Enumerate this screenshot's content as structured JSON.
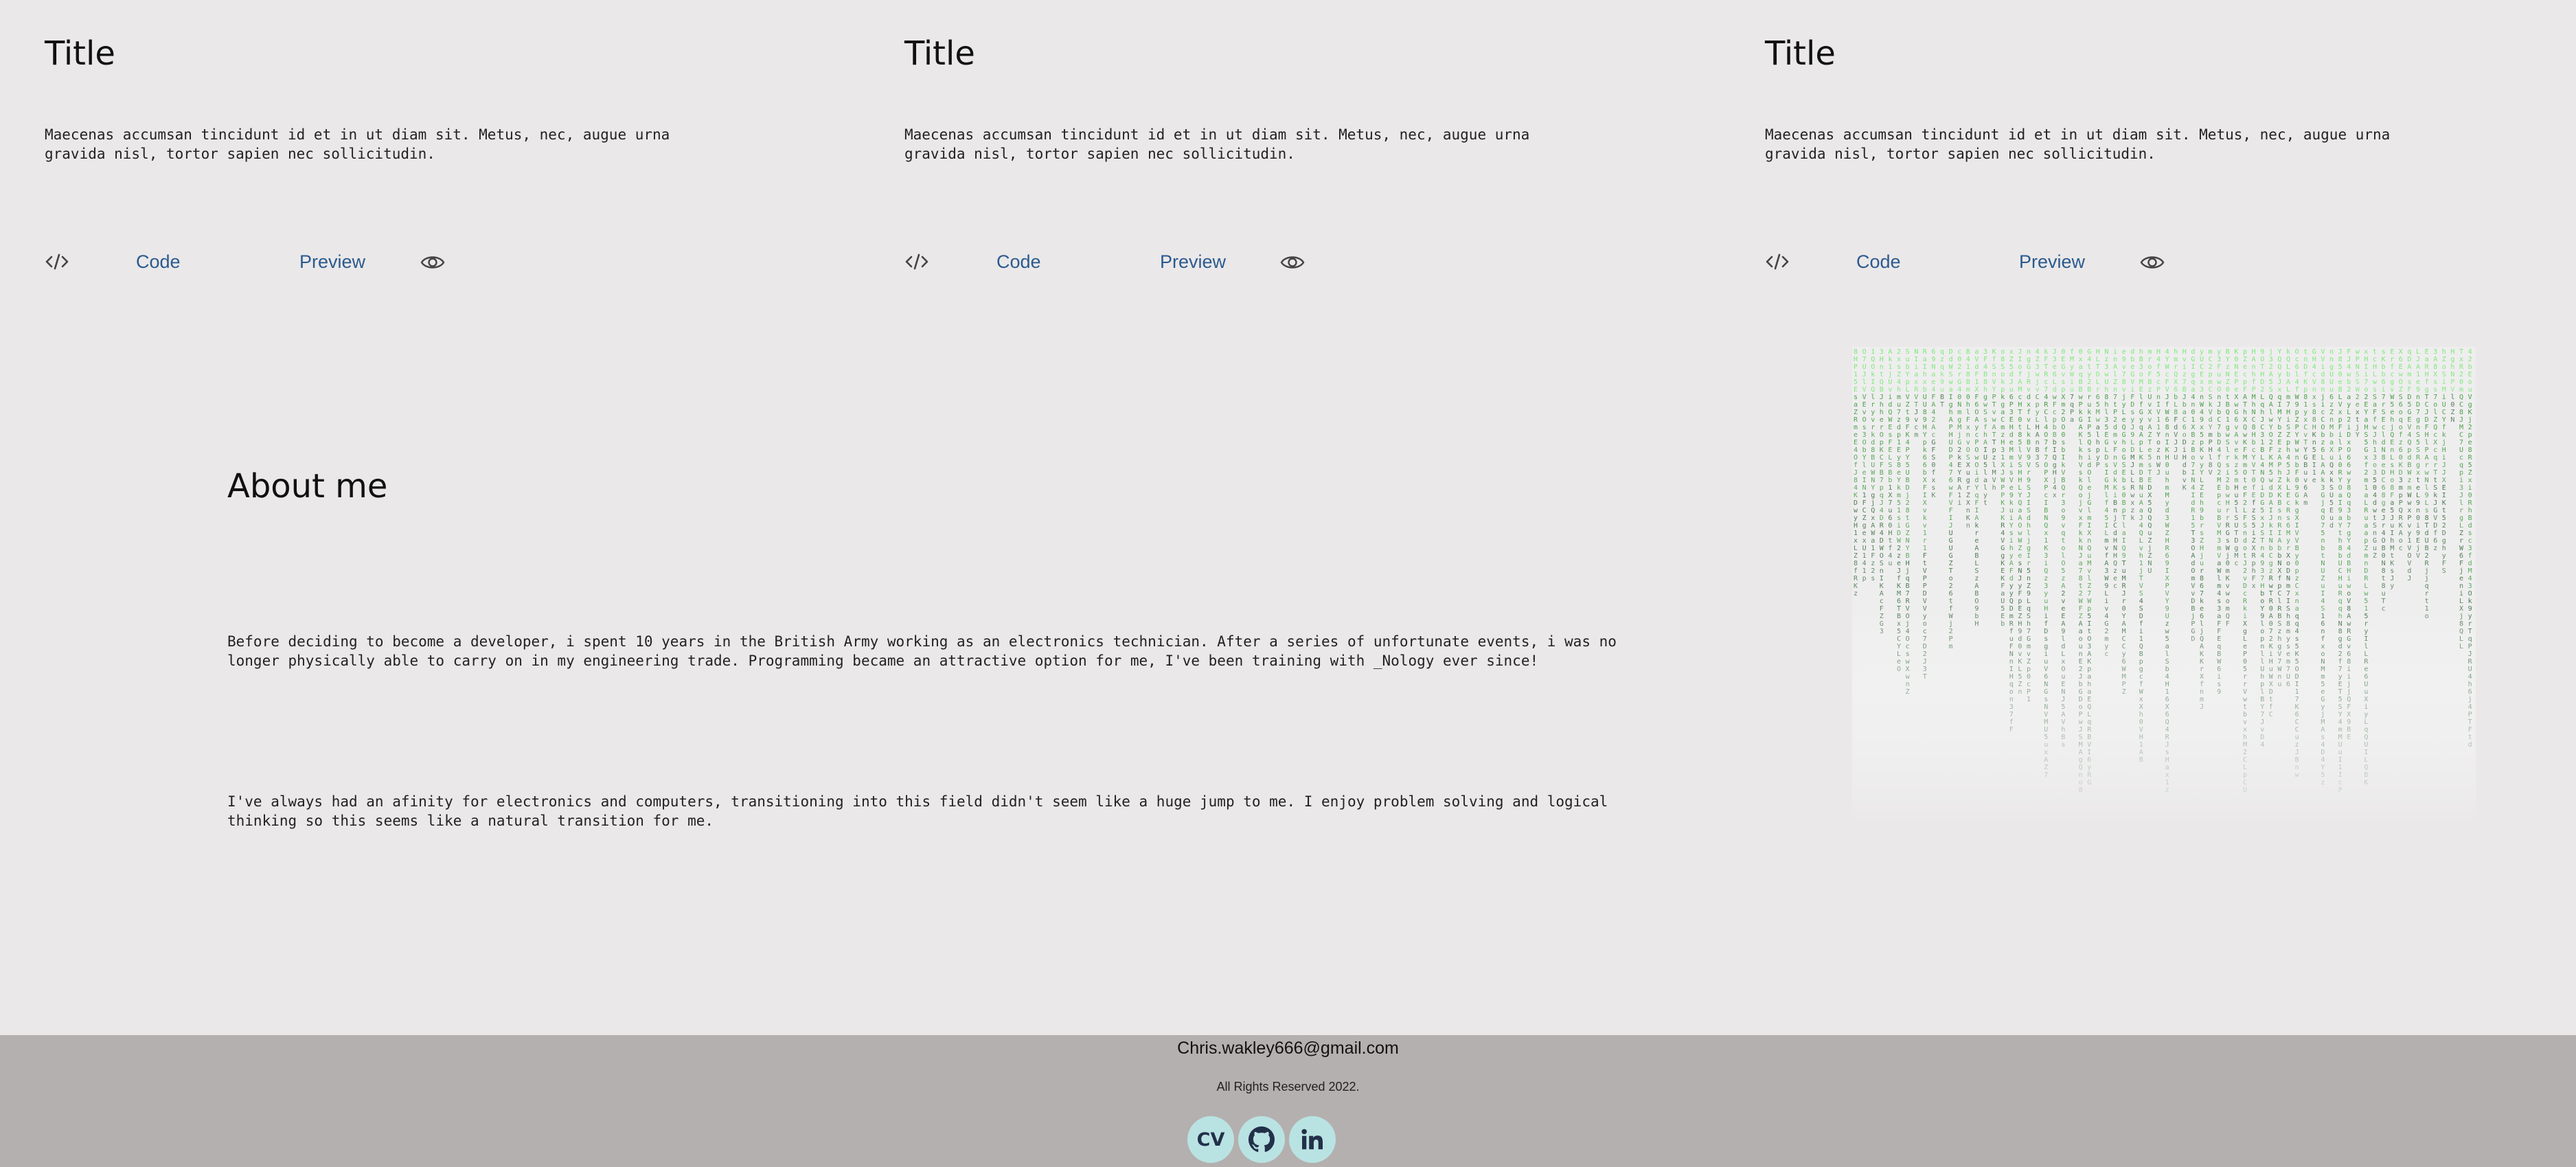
{
  "projects": [
    {
      "title": "Title",
      "description": "Maecenas accumsan tincidunt id et in ut diam sit. Metus, nec, augue urna gravida nisl, tortor sapien nec sollicitudin.",
      "code_label": "Code",
      "preview_label": "Preview"
    },
    {
      "title": "Title",
      "description": "Maecenas accumsan tincidunt id et in ut diam sit. Metus, nec, augue urna gravida nisl, tortor sapien nec sollicitudin.",
      "code_label": "Code",
      "preview_label": "Preview"
    },
    {
      "title": "Title",
      "description": "Maecenas accumsan tincidunt id et in ut diam sit. Metus, nec, augue urna gravida nisl, tortor sapien nec sollicitudin.",
      "code_label": "Code",
      "preview_label": "Preview"
    }
  ],
  "about": {
    "title": "About me",
    "paragraphs": [
      "Before deciding to become a developer, i spent 10 years in the British Army working as an electronics technician. After a series of unfortunate events, i was no longer physically able to carry on in my engineering trade. Programming became an attractive option for me, I've been training with _Nology ever since!",
      "I've always had an afinity for electronics and computers, transitioning into this field didn't seem like a huge jump to me. I enjoy problem solving and logical thinking so this seems like a natural transition for me."
    ]
  },
  "footer": {
    "email": "Chris.wakley666@gmail.com",
    "rights": "All Rights Reserved 2022.",
    "cv_label": "CV"
  },
  "icons": {
    "code": "code-brackets-icon",
    "preview": "eye-icon",
    "github": "github-icon",
    "linkedin": "linkedin-icon",
    "matrix_image": "matrix-code-rain"
  },
  "colors": {
    "background": "#eae8e9",
    "link": "#2b5a8e",
    "footer_bg": "#b4b0af",
    "social_bg": "#b9e3e2",
    "matrix_green": "#4cdc4c"
  }
}
